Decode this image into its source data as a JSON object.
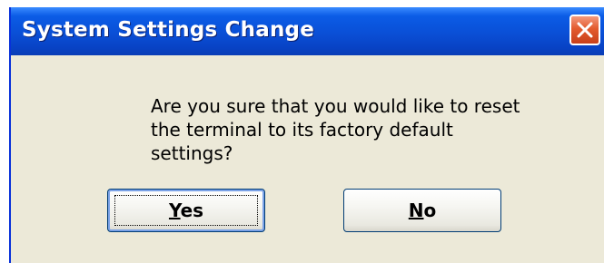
{
  "window": {
    "title": "System Settings Change",
    "close_icon": "close-icon"
  },
  "message": {
    "text": "Are you sure that you would like to reset\nthe terminal to its factory default\nsettings?"
  },
  "buttons": {
    "yes": {
      "mnemonic": "Y",
      "rest": "es"
    },
    "no": {
      "mnemonic": "N",
      "rest": "o"
    }
  },
  "colors": {
    "titlebar": "#0a4fd6",
    "dialog_bg": "#ece9d8",
    "close_button": "#e35b2e",
    "button_border": "#003c74"
  }
}
